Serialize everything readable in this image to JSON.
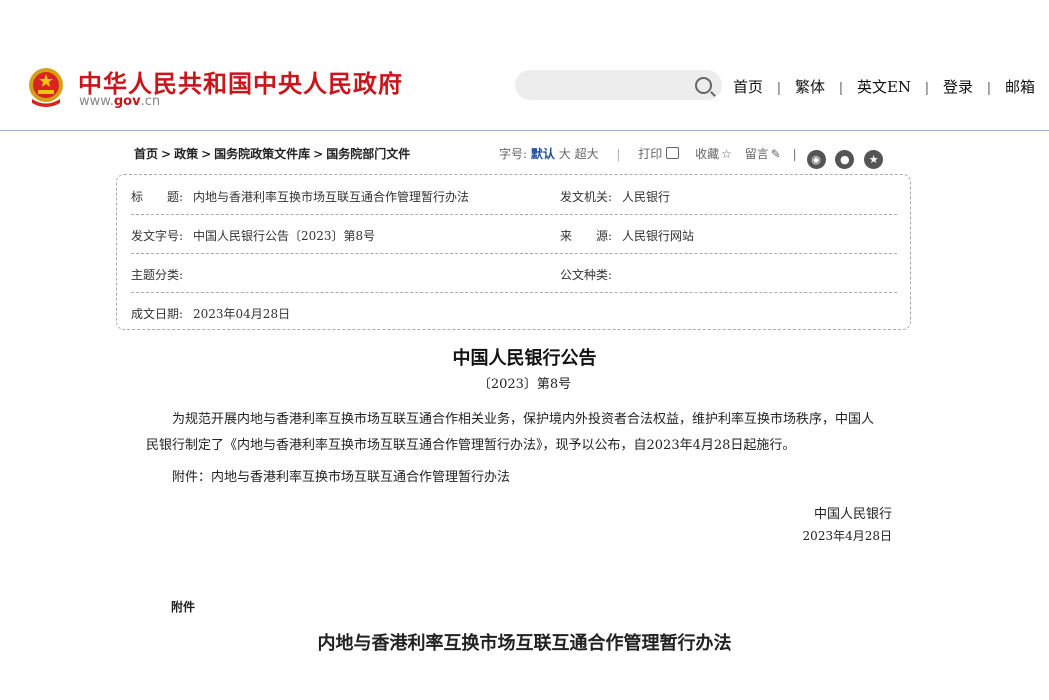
{
  "header": {
    "site_name": "中华人民共和国中央人民政府",
    "domain_prefix": "www.",
    "domain_highlight": "gov",
    "domain_suffix": ".cn",
    "nav": [
      "首页",
      "繁体",
      "英文EN",
      "登录",
      "邮箱"
    ],
    "nav_separator": "|"
  },
  "breadcrumb": [
    "首页",
    "政策",
    "国务院政策文件库",
    "国务院部门文件"
  ],
  "breadcrumb_separator": ">",
  "tools": {
    "font_size_label": "字号:",
    "sizes": [
      "默认",
      "大",
      "超大"
    ],
    "separator": "|",
    "print": "打印",
    "favorite": "收藏",
    "comment": "留言"
  },
  "meta": {
    "title_label": "标　　题:",
    "title_value": "内地与香港利率互换市场互联互通合作管理暂行办法",
    "issuer_label": "发文机关:",
    "issuer_value": "人民银行",
    "docnum_label": "发文字号:",
    "docnum_value": "中国人民银行公告〔2023〕第8号",
    "source_label": "来　　源:",
    "source_value": "人民银行网站",
    "topic_label": "主题分类:",
    "topic_value": "",
    "doctype_label": "公文种类:",
    "doctype_value": "",
    "date_label": "成文日期:",
    "date_value": "2023年04月28日"
  },
  "body": {
    "title": "中国人民银行公告",
    "docno": "〔2023〕第8号",
    "paragraph": "为规范开展内地与香港利率互换市场互联互通合作相关业务，保护境内外投资者合法权益，维护利率互换市场秩序，中国人民银行制定了《内地与香港利率互换市场互联互通合作管理暂行办法》，现予以公布，自2023年4月28日起施行。",
    "attachment_line": "附件：内地与香港利率互换市场互联互通合作管理暂行办法",
    "sign_org": "中国人民银行",
    "sign_date": "2023年4月28日",
    "attachment_heading": "附件",
    "attachment_title": "内地与香港利率互换市场互联互通合作管理暂行办法"
  },
  "colors": {
    "brand_red": "#c8161d",
    "link_blue": "#1f4e9c",
    "divider": "#9bb0c8"
  },
  "icons": [
    "national-emblem-icon",
    "search-icon",
    "print-icon",
    "star-icon",
    "pen-icon",
    "weibo-icon",
    "wechat-icon",
    "qzone-icon"
  ]
}
